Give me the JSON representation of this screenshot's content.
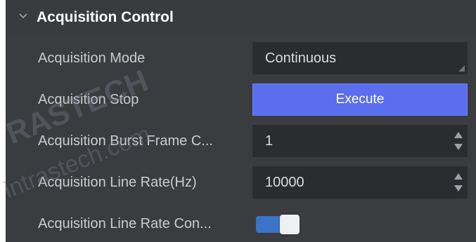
{
  "section": {
    "title": "Acquisition Control",
    "expanded": true
  },
  "rows": [
    {
      "label": "Acquisition Mode",
      "control": "dropdown",
      "value": "Continuous"
    },
    {
      "label": "Acquisition Stop",
      "control": "button",
      "value": "Execute"
    },
    {
      "label": "Acquisition Burst Frame C...",
      "control": "spinbox",
      "value": "1"
    },
    {
      "label": "Acquisition Line Rate(Hz)",
      "control": "spinbox",
      "value": "10000"
    },
    {
      "label": "Acquisition Line Rate Con...",
      "control": "toggle",
      "value": "on"
    }
  ],
  "watermark": {
    "line1": "RASTECH",
    "line2": "intrastech.com"
  },
  "colors": {
    "panel_bg": "#3b3c40",
    "field_bg": "#2b2c2f",
    "execute_bg": "#5b6ef0",
    "toggle_on": "#3b73c8"
  }
}
